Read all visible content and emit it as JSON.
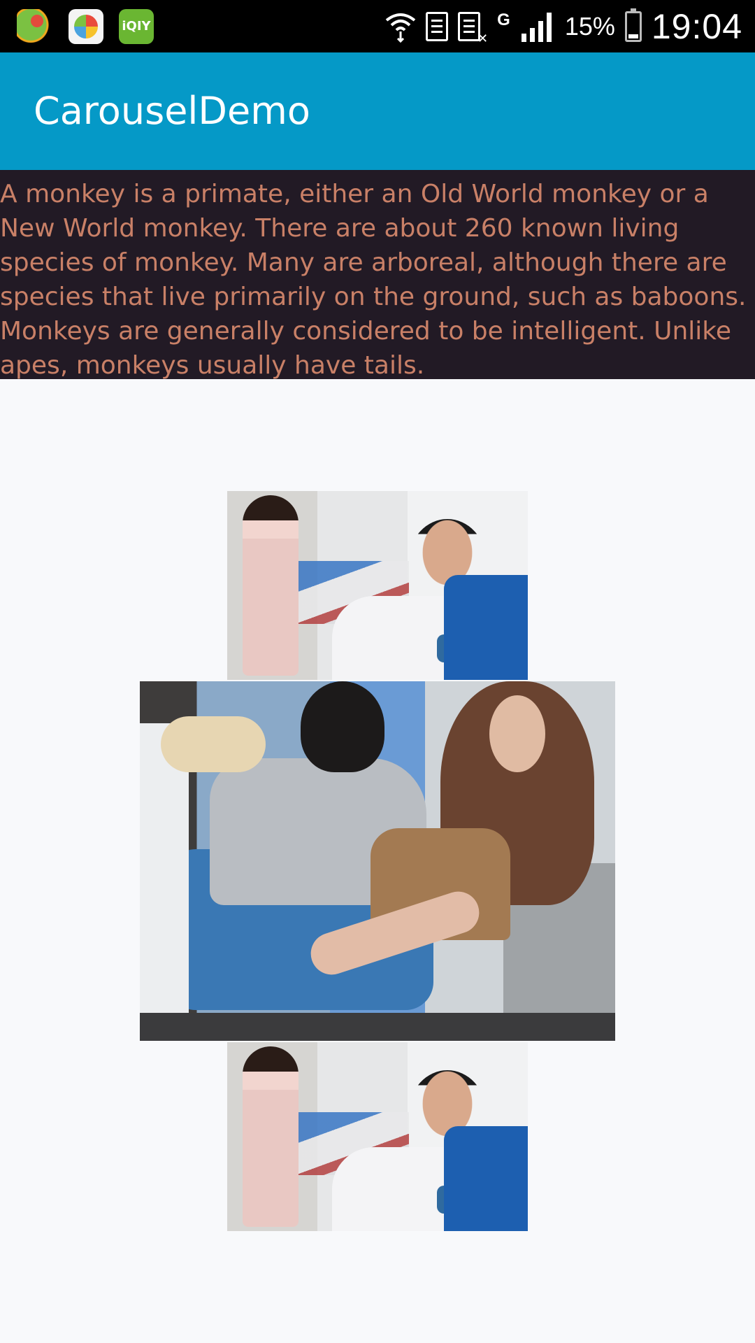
{
  "status_bar": {
    "app_icons": [
      "game-center-icon",
      "app-store-icon",
      "iqiyi-icon"
    ],
    "iqiyi_label": "iQIY",
    "network_type": "G",
    "battery_percent": "15%",
    "time": "19:04"
  },
  "app_bar": {
    "title": "CarouselDemo"
  },
  "description": {
    "text": "A monkey is a primate, either an Old World monkey or a New World monkey. There are about 260 known living species of monkey. Many are arboreal, although there are species that live primarily on the ground, such as baboons. Monkeys are generally considered to be intelligent. Unlike apes, monkeys usually have tails."
  },
  "carousel": {
    "items": [
      {
        "position": "previous",
        "scene": "nurse-and-blood-donor"
      },
      {
        "position": "current",
        "scene": "donors-in-chairs"
      },
      {
        "position": "next",
        "scene": "nurse-and-blood-donor"
      }
    ]
  },
  "colors": {
    "app_bar": "#0599c7",
    "description_background": "#221a25",
    "description_text": "#c98067",
    "page_background": "#f8f9fb"
  }
}
